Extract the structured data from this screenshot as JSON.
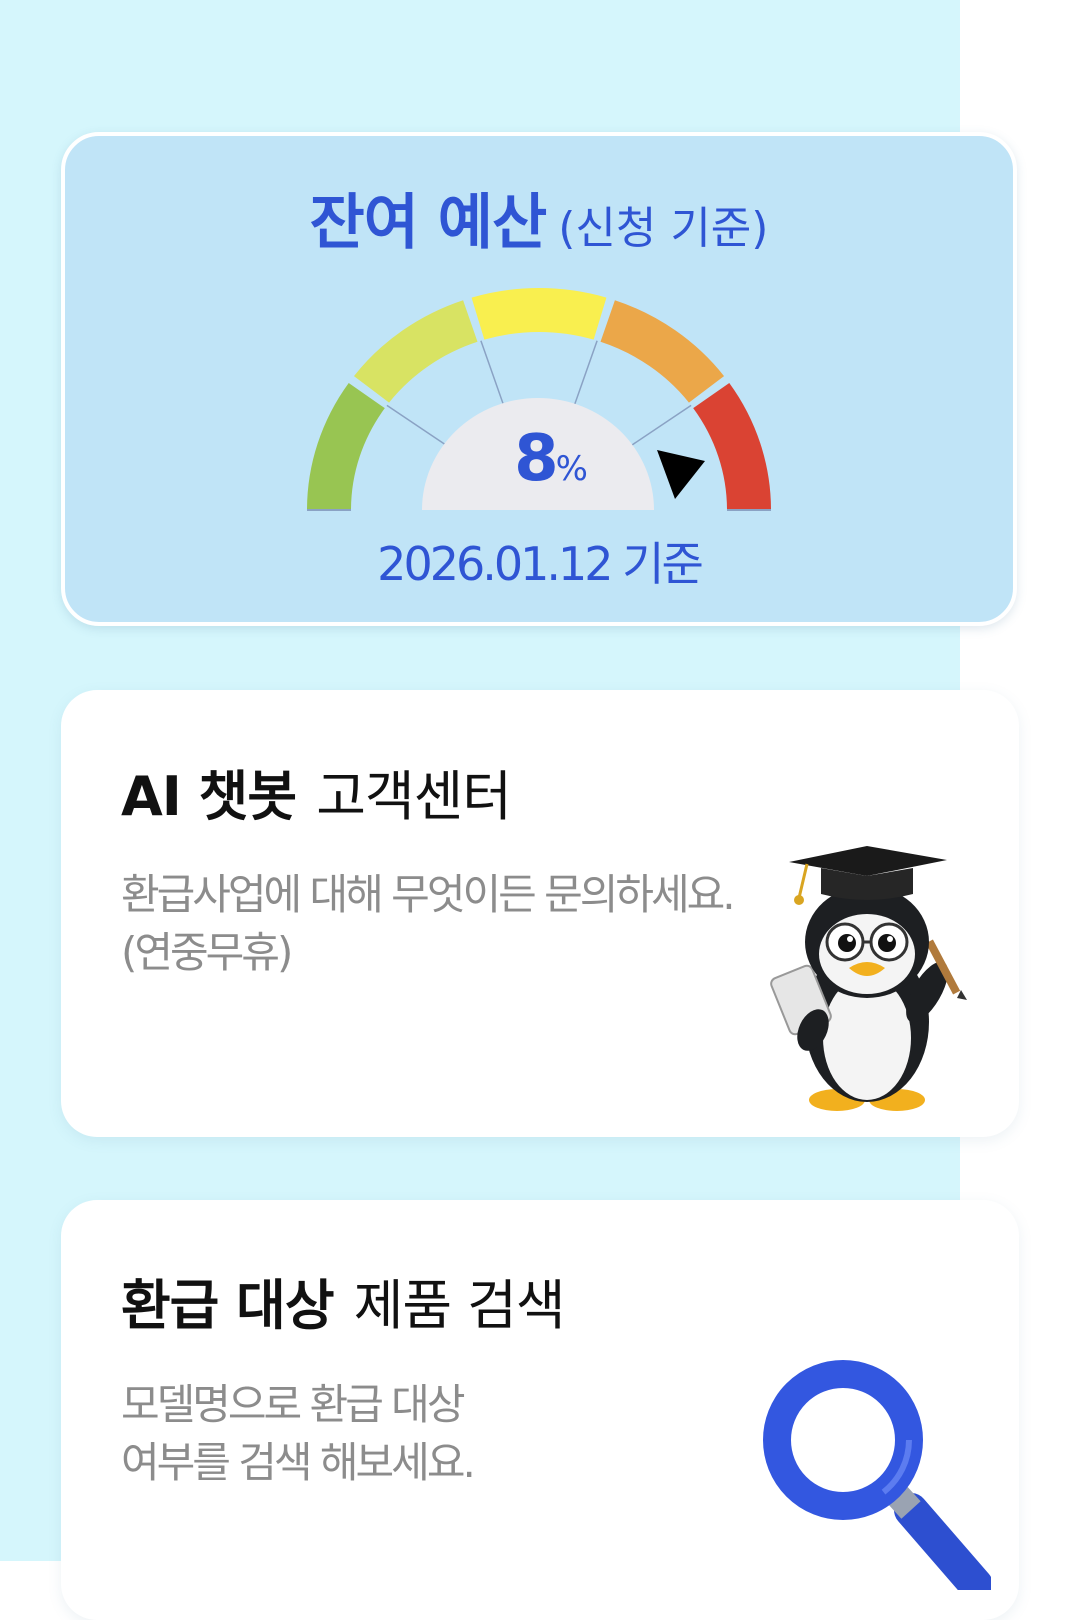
{
  "budget": {
    "title_strong": "잔여 예산",
    "title_light": "(신청 기준)",
    "percent_value": "8",
    "percent_unit": "%",
    "percent_level": 8,
    "date_text": "2026.01.12 기준",
    "gauge_colors": [
      "#98c552",
      "#d8e363",
      "#f9ef4f",
      "#eba749",
      "#da4333"
    ]
  },
  "chatbot": {
    "title_strong": "AI 챗봇",
    "title_light": "고객센터",
    "desc_line1": "환급사업에 대해 무엇이든 문의하세요.",
    "desc_line2": "(연중무휴)",
    "illustration": "penguin-graduate-icon"
  },
  "search": {
    "title_strong": "환급 대상",
    "title_light": "제품 검색",
    "desc_line1": "모델명으로 환급 대상",
    "desc_line2": "여부를 검색 해보세요.",
    "illustration": "magnifier-icon"
  }
}
